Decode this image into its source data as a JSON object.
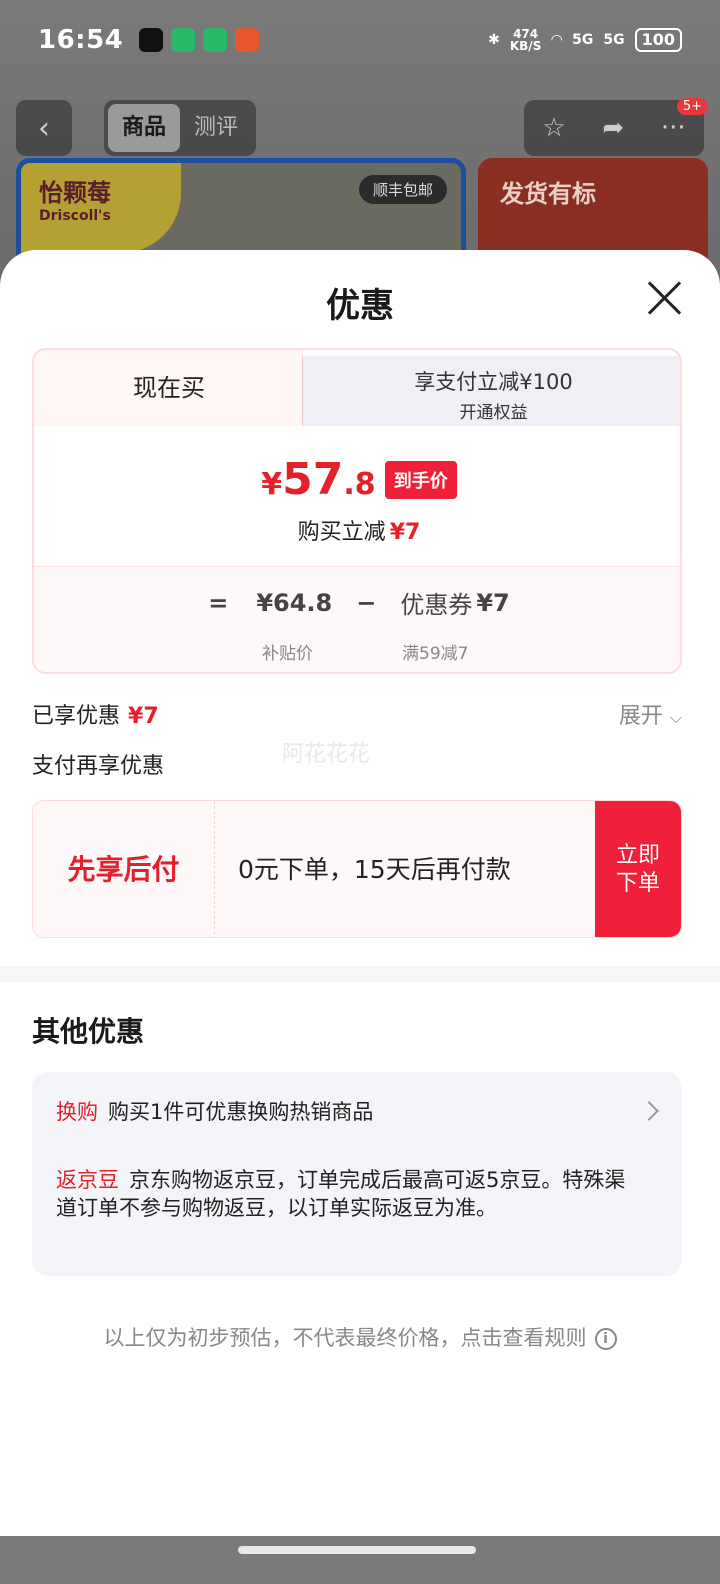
{
  "status_bar": {
    "time": "16:54",
    "net_speed": "474",
    "net_unit": "KB/S",
    "signal1": "5G",
    "signal2": "5G",
    "battery": "100"
  },
  "background": {
    "tabs": [
      "商品",
      "测评"
    ],
    "badge": "5+",
    "banner_left_logo": "怡颗莓",
    "banner_left_logo_sub": "Driscoll's",
    "banner_left_tag": "顺丰包邮",
    "banner_right_text": "发货有标"
  },
  "sheet": {
    "title": "优惠",
    "tabs": {
      "active": "现在买",
      "inactive_line1": "享支付立减¥100",
      "inactive_line2": "开通权益"
    },
    "final_price": {
      "currency": "¥",
      "integer": "57",
      "decimal": ".8",
      "tag": "到手价"
    },
    "reduce": {
      "label": "购买立减",
      "amount": "¥7"
    },
    "formula": {
      "equals": "=",
      "subsidy_price": "¥64.8",
      "minus": "−",
      "coupon_label": "优惠券",
      "coupon_amount": "¥7",
      "subsidy_label": "补贴价",
      "coupon_rule": "满59减7"
    },
    "enjoyed": {
      "label": "已享优惠",
      "amount": "¥7",
      "expand": "展开"
    },
    "pay_more": "支付再享优惠",
    "watermark": "阿花花花",
    "bnpl": {
      "title": "先享后付",
      "desc": "0元下单，15天后再付款",
      "button": "立即下单"
    },
    "other": {
      "title": "其他优惠",
      "swap_tag": "换购",
      "swap_text": "购买1件可优惠换购热销商品",
      "bean_tag": "返京豆",
      "bean_text": "京东购物返京豆，订单完成后最高可返5京豆。特殊渠道订单不参与购物返豆，以订单实际返豆为准。"
    },
    "disclaimer": "以上仅为初步预估，不代表最终价格，点击查看规则"
  },
  "colors": {
    "accent_red": "#e4202b",
    "button_red": "#f0203a"
  }
}
